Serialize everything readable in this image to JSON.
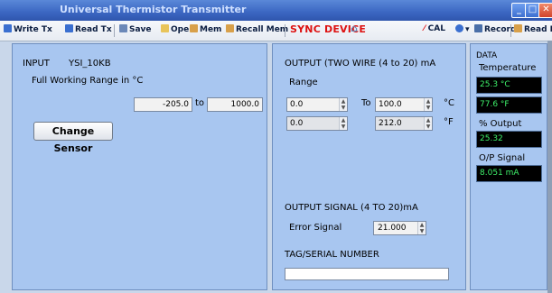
{
  "window": {
    "title": "Universal Thermistor Transmitter"
  },
  "toolbar": {
    "write_tx": "Write Tx",
    "read_tx": "Read Tx",
    "save": "Save",
    "open": "Open",
    "mem": "Mem",
    "recall_mem": "Recall Mem",
    "sync_device": "SYNC DEVICE",
    "cal": "CAL",
    "record": "Record",
    "read_data": "Read Data"
  },
  "input": {
    "label": "INPUT",
    "sensor": "YSI_10KB",
    "range_title": "Full Working Range in °C",
    "range_min": "-205.0",
    "to": "to",
    "range_max": "1000.0",
    "change_sensor": "Change Sensor"
  },
  "output": {
    "title": "OUTPUT (TWO WIRE (4 to 20) mA",
    "range_label": "Range",
    "to": "To",
    "c_min": "0.0",
    "c_max": "100.0",
    "c_unit": "°C",
    "f_min": "0.0",
    "f_max": "212.0",
    "f_unit": "°F",
    "signal_title": "OUTPUT SIGNAL (4 TO 20)mA",
    "error_signal_label": "Error Signal",
    "error_signal_value": "21.000",
    "tag_label": "TAG/SERIAL NUMBER",
    "tag_value": ""
  },
  "data": {
    "title": "DATA",
    "temperature_label": "Temperature",
    "temp_c": "25.3 °C",
    "temp_f": "77.6 °F",
    "output_label": "% Output",
    "output_value": "25.32",
    "op_signal_label": "O/P Signal",
    "op_signal_value": "8.051 mA"
  },
  "colors": {
    "panel": "#a8c6f0",
    "accent_red": "#d11111",
    "display_green": "#3ef06a"
  }
}
